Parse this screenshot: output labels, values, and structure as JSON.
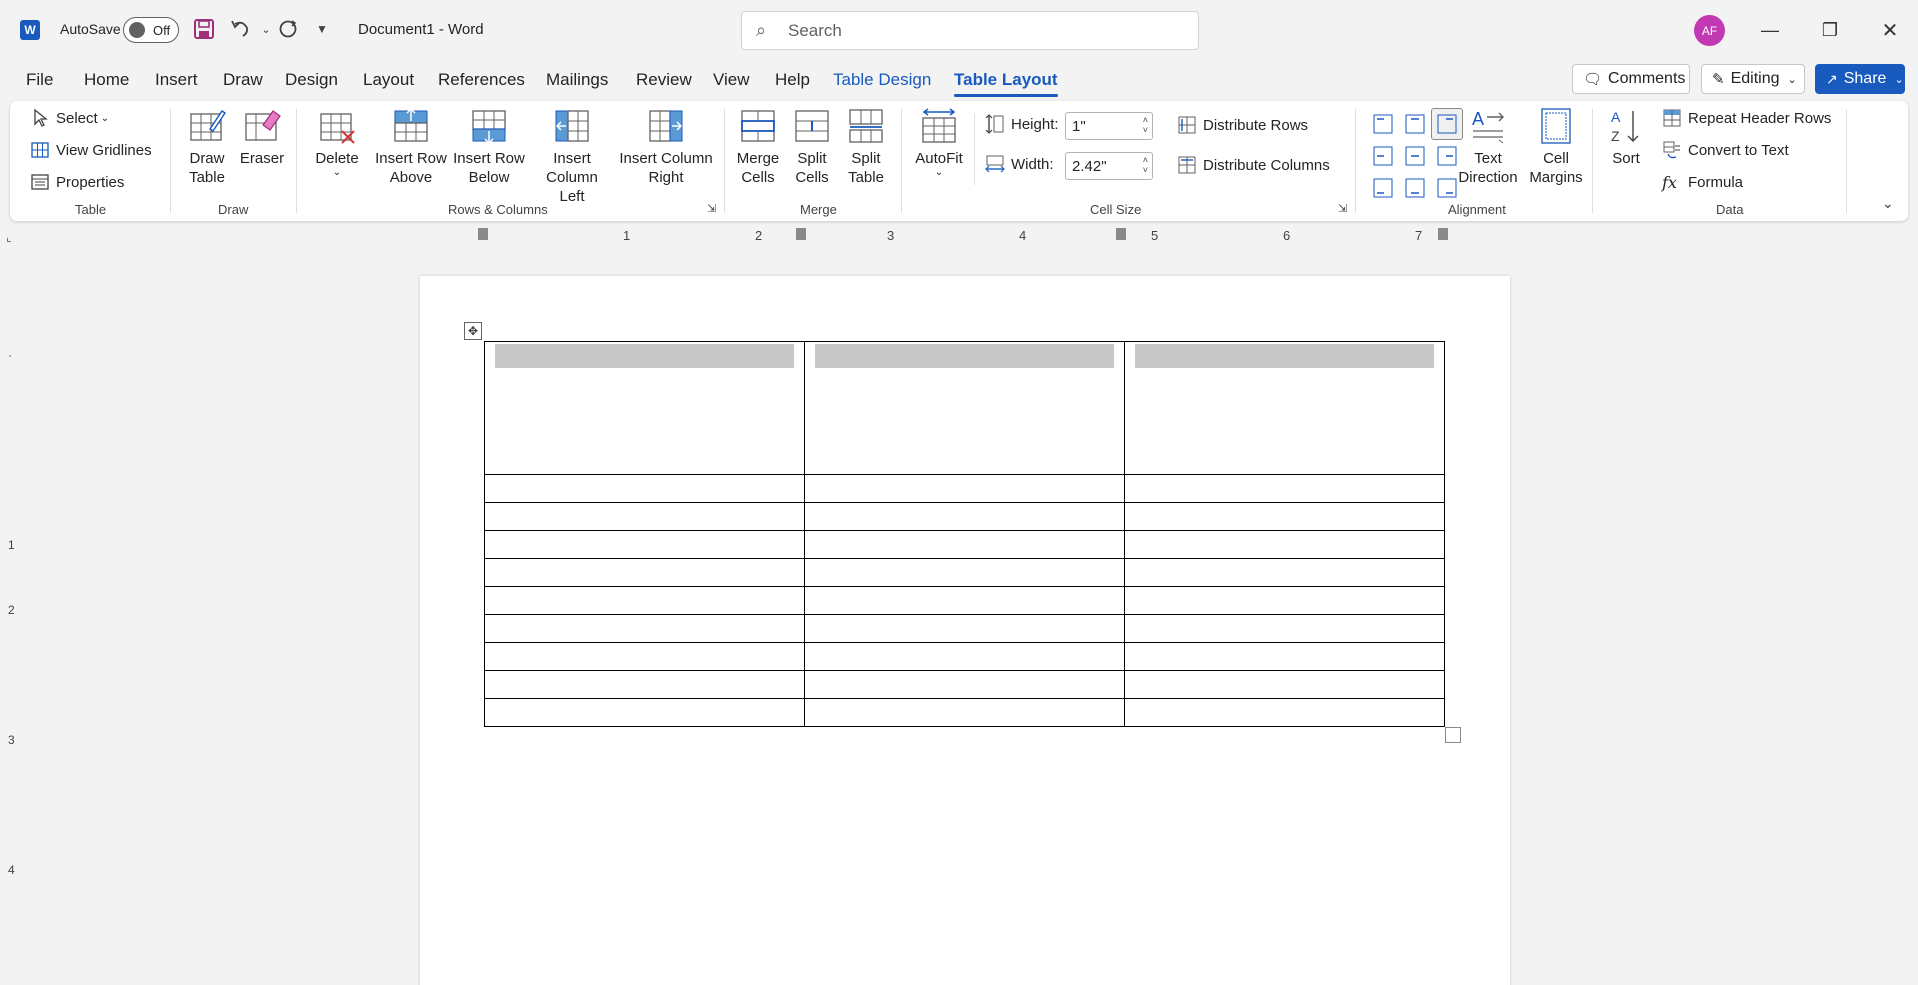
{
  "titlebar": {
    "app_logo": "W",
    "autosave_label": "AutoSave",
    "autosave_state": "Off",
    "document_title": "Document1  -  Word",
    "search_placeholder": "Search",
    "avatar_initials": "AF"
  },
  "tabs": [
    "File",
    "Home",
    "Insert",
    "Draw",
    "Design",
    "Layout",
    "References",
    "Mailings",
    "Review",
    "View",
    "Help",
    "Table Design",
    "Table Layout"
  ],
  "active_tab": "Table Layout",
  "right_buttons": {
    "comments": "Comments",
    "editing": "Editing",
    "share": "Share"
  },
  "ribbon": {
    "table": {
      "label": "Table",
      "select": "Select",
      "view_gridlines": "View Gridlines",
      "properties": "Properties"
    },
    "draw": {
      "label": "Draw",
      "draw_table": "Draw Table",
      "eraser": "Eraser"
    },
    "rows_columns": {
      "label": "Rows & Columns",
      "delete": "Delete",
      "insert_row_above": "Insert Row Above",
      "insert_row_below": "Insert Row Below",
      "insert_column_left": "Insert Column Left",
      "insert_column_right": "Insert Column Right"
    },
    "merge": {
      "label": "Merge",
      "merge_cells": "Merge Cells",
      "split_cells": "Split Cells",
      "split_table": "Split Table"
    },
    "cell_size": {
      "label": "Cell Size",
      "autofit": "AutoFit",
      "height_label": "Height:",
      "height_value": "1\"",
      "width_label": "Width:",
      "width_value": "2.42\"",
      "distribute_rows": "Distribute Rows",
      "distribute_columns": "Distribute Columns"
    },
    "alignment": {
      "label": "Alignment",
      "text_direction": "Text Direction",
      "cell_margins": "Cell Margins"
    },
    "data": {
      "label": "Data",
      "sort": "Sort",
      "repeat_header_rows": "Repeat Header Rows",
      "convert_to_text": "Convert to Text",
      "formula": "Formula"
    }
  },
  "ruler": {
    "h_numbers": [
      "1",
      "2",
      "3",
      "4",
      "5",
      "6",
      "7"
    ],
    "v_numbers": [
      "1",
      "2",
      "3",
      "4"
    ]
  },
  "colors": {
    "accent": "#185abd",
    "avatar": "#c239b3",
    "header_shade": "#c8c8c8"
  },
  "table": {
    "columns": 3,
    "body_rows": 9
  }
}
